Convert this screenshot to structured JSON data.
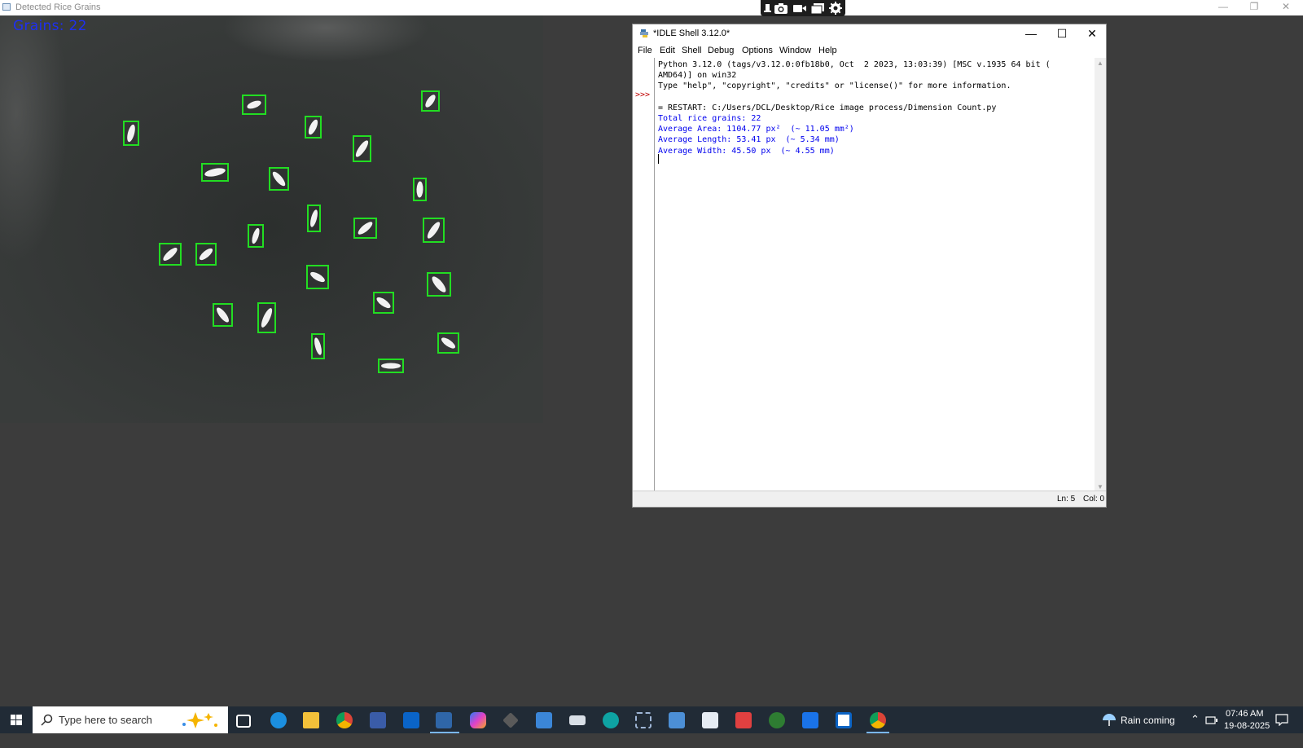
{
  "viewer": {
    "title": "Detected Rice Grains",
    "grains_label": "Grains: 22",
    "buttons": {
      "minimize": "—",
      "restore": "❐",
      "close": "✕"
    }
  },
  "capture_toolbar": {
    "icons": [
      "pin-icon",
      "camera-icon",
      "video-icon",
      "window-icon",
      "gear-icon"
    ]
  },
  "idle": {
    "title": "*IDLE Shell 3.12.0*",
    "buttons": {
      "minimize": "—",
      "maximize": "☐",
      "close": "✕"
    },
    "menu": [
      "File",
      "Edit",
      "Shell",
      "Debug",
      "Options",
      "Window",
      "Help"
    ],
    "prompt": ">>>",
    "lines": {
      "l1": "Python 3.12.0 (tags/v3.12.0:0fb18b0, Oct  2 2023, 13:03:39) [MSC v.1935 64 bit (",
      "l2": "AMD64)] on win32",
      "l3": "Type \"help\", \"copyright\", \"credits\" or \"license()\" for more information.",
      "l4": "= RESTART: C:/Users/DCL/Desktop/Rice image process/Dimension Count.py",
      "l5": "Total rice grains: 22",
      "l6": "Average Area: 1104.77 px²  (~ 11.05 mm²)",
      "l7": "Average Length: 53.41 px  (~ 5.34 mm)",
      "l8": "Average Width: 45.50 px  (~ 4.55 mm)"
    },
    "status": {
      "ln": "Ln: 5",
      "col": "Col: 0"
    }
  },
  "taskbar": {
    "search_placeholder": "Type here to search",
    "weather": "Rain coming",
    "time": "07:46 AM",
    "date": "19-08-2025"
  }
}
